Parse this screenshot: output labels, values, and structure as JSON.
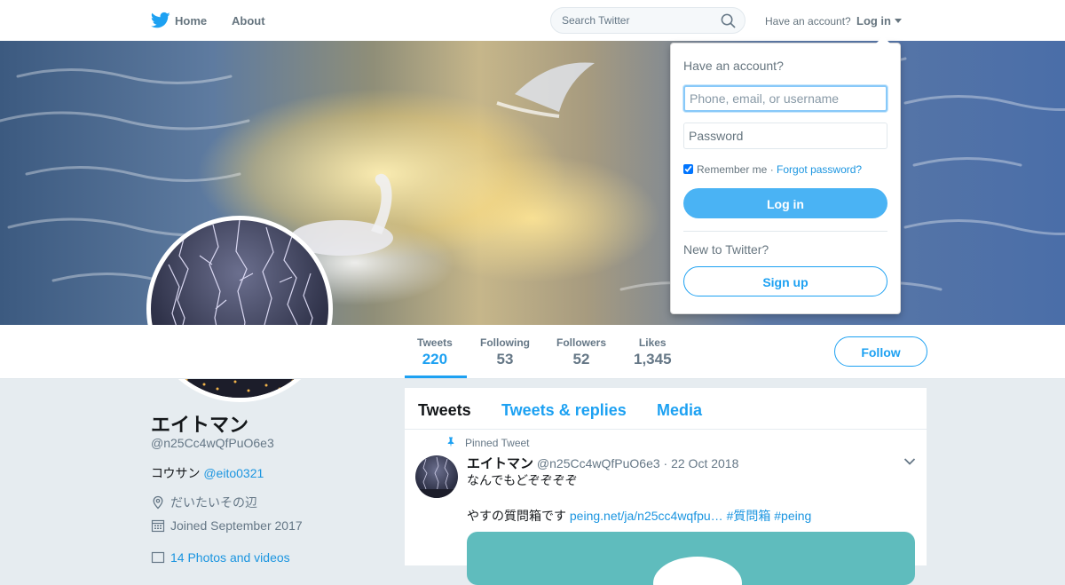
{
  "topnav": {
    "logo_icon": "twitter-bird-icon",
    "home_label": "Home",
    "about_label": "About",
    "search_placeholder": "Search Twitter",
    "have_account": "Have an account?",
    "login_label": "Log in"
  },
  "profile_nav": {
    "stats": [
      {
        "label": "Tweets",
        "value": "220"
      },
      {
        "label": "Following",
        "value": "53"
      },
      {
        "label": "Followers",
        "value": "52"
      },
      {
        "label": "Likes",
        "value": "1,345"
      }
    ],
    "follow_label": "Follow"
  },
  "profile": {
    "name": "エイトマン",
    "handle": "@n25Cc4wQfPuO6e3",
    "bio_text": "コウサン ",
    "bio_mention": "@eito0321",
    "location": "だいたいその辺",
    "joined": "Joined September 2017",
    "photos": "14 Photos and videos"
  },
  "timeline": {
    "tabs": [
      "Tweets",
      "Tweets & replies",
      "Media"
    ],
    "pinned_label": "Pinned Tweet",
    "tweet": {
      "name": "エイトマン",
      "handle": "@n25Cc4wQfPuO6e3",
      "separator": "·",
      "date": "22 Oct 2018",
      "line1": "なんでもどぞぞぞぞ",
      "line2_text": "やすの質問箱です ",
      "link": "peing.net/ja/n25cc4wqfpu…",
      "hashtag1": "#質問箱",
      "hashtag2": "#peing"
    }
  },
  "login_dropdown": {
    "title": "Have an account?",
    "username_placeholder": "Phone, email, or username",
    "password_placeholder": "Password",
    "remember_label": "Remember me",
    "dot": "·",
    "forgot_label": "Forgot password?",
    "login_button": "Log in",
    "new_label": "New to Twitter?",
    "signup_button": "Sign up"
  },
  "colors": {
    "accent": "#1da1f2",
    "link": "#1b95e0",
    "login_button_bg": "#4ab3f4",
    "page_bg": "#e6ecf0"
  }
}
